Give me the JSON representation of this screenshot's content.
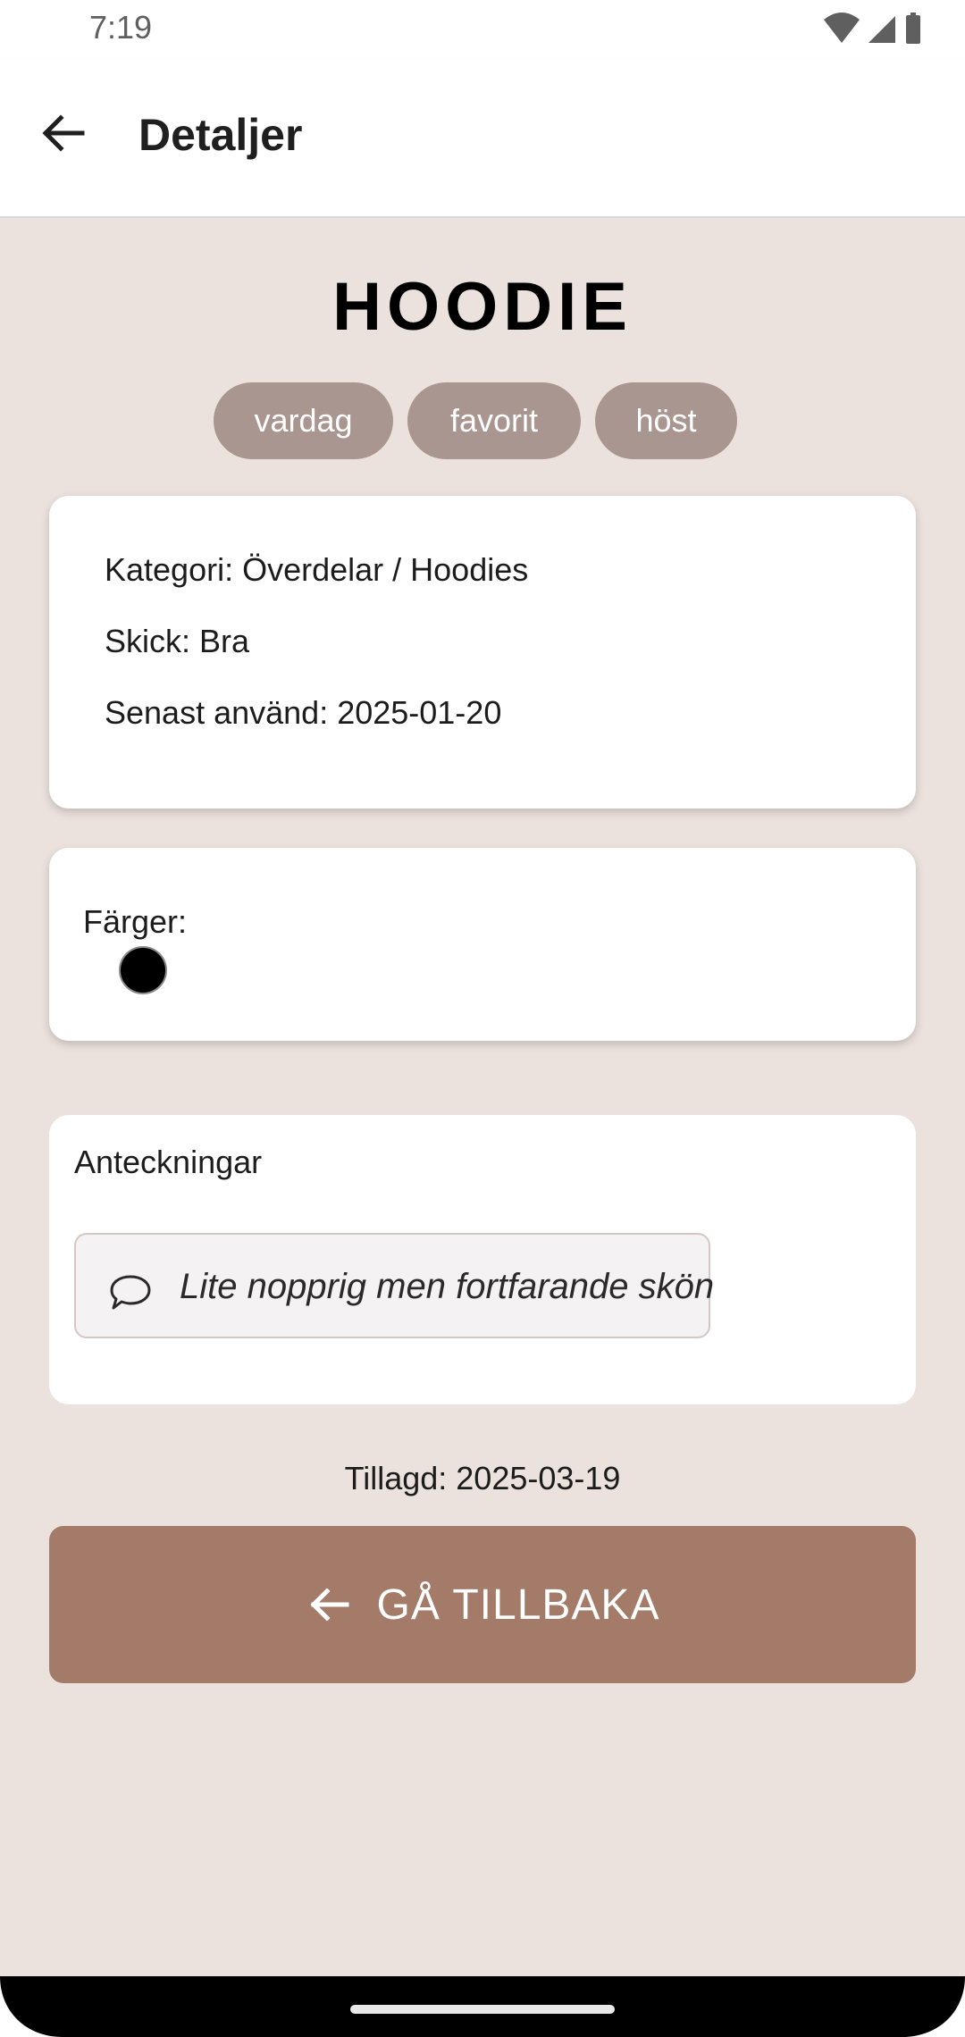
{
  "status_bar": {
    "time": "7:19",
    "icons": [
      "wifi-icon",
      "signal-icon",
      "battery-icon"
    ]
  },
  "app_bar": {
    "title": "Detaljer",
    "back_icon": "arrow-left-icon"
  },
  "item": {
    "title": "HOODIE",
    "tags": [
      "vardag",
      "favorit",
      "höst"
    ],
    "category_line": "Kategori: Överdelar / Hoodies",
    "condition_line": "Skick: Bra",
    "last_used_line": "Senast använd: 2025-01-20"
  },
  "colors": {
    "label": "Färger:",
    "swatches": [
      "#000000"
    ]
  },
  "notes": {
    "label": "Anteckningar",
    "icon": "speech-bubble-icon",
    "text": "Lite nopprig men fortfarande skön"
  },
  "added": "Tillagd: 2025-03-19",
  "go_back_button": {
    "label": "GÅ TILLBAKA",
    "icon": "arrow-left-icon"
  },
  "theme": {
    "background": "#ebe1dd",
    "tag": "#a99690",
    "button": "#a47a69"
  }
}
